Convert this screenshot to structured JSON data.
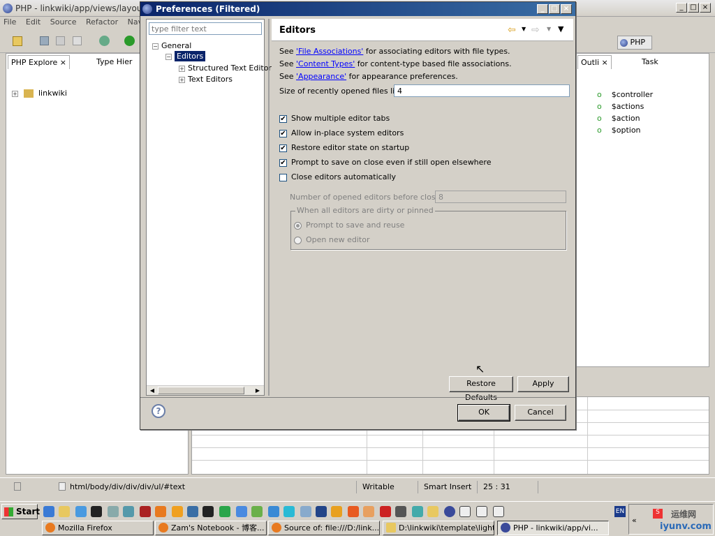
{
  "window": {
    "title": "PHP - linkwiki/app/views/layou"
  },
  "menu": [
    "File",
    "Edit",
    "Source",
    "Refactor",
    "Naviga"
  ],
  "left_panel": {
    "tabs": [
      "PHP Explore",
      "Type Hier"
    ],
    "tree": [
      "linkwiki"
    ]
  },
  "perspective": {
    "label": "PHP"
  },
  "outline": {
    "tabs": [
      "Outli",
      "Task"
    ],
    "items": [
      "$controller",
      "$actions",
      "$action",
      "$option"
    ]
  },
  "dialog": {
    "title": "Preferences (Filtered)",
    "filter_placeholder": "type filter text",
    "tree": {
      "root": "General",
      "selected": "Editors",
      "children": [
        "Structured Text Editor",
        "Text Editors"
      ]
    },
    "page_title": "Editors",
    "links": [
      {
        "prefix": "See ",
        "link": "'File Associations'",
        "suffix": " for associating editors with file types."
      },
      {
        "prefix": "See ",
        "link": "'Content Types'",
        "suffix": " for content-type based file associations."
      },
      {
        "prefix": "See ",
        "link": "'Appearance'",
        "suffix": " for appearance preferences."
      }
    ],
    "recent_label": "Size of recently opened files list:",
    "recent_value": "4",
    "checkboxes": [
      {
        "label": "Show multiple editor tabs",
        "checked": true
      },
      {
        "label": "Allow in-place system editors",
        "checked": true
      },
      {
        "label": "Restore editor state on startup",
        "checked": true
      },
      {
        "label": "Prompt to save on close even if still open elsewhere",
        "checked": true
      },
      {
        "label": "Close editors automatically",
        "checked": false
      }
    ],
    "num_editors_label": "Number of opened editors before closing:",
    "num_editors_value": "8",
    "group_title": "When all editors are dirty or pinned",
    "radios": [
      {
        "label": "Prompt to save and reuse",
        "selected": true
      },
      {
        "label": "Open new editor",
        "selected": false
      }
    ],
    "restore_defaults": "Restore Defaults",
    "apply": "Apply",
    "ok": "OK",
    "cancel": "Cancel",
    "help": "?"
  },
  "statusbar": {
    "path": "html/body/div/div/div/ul/#text",
    "writable": "Writable",
    "insert": "Smart Insert",
    "position": "25 : 31"
  },
  "taskbar": {
    "start": "Start",
    "lang": "EN",
    "tasks": [
      "Mozilla Firefox",
      "Zam's Notebook - 博客...",
      "Source of: file:///D:/link...",
      "D:\\linkwiki\\template\\light...",
      "PHP - linkwiki/app/vi..."
    ],
    "watermark_cn": "运维网",
    "watermark_url": "iyunv.com"
  }
}
